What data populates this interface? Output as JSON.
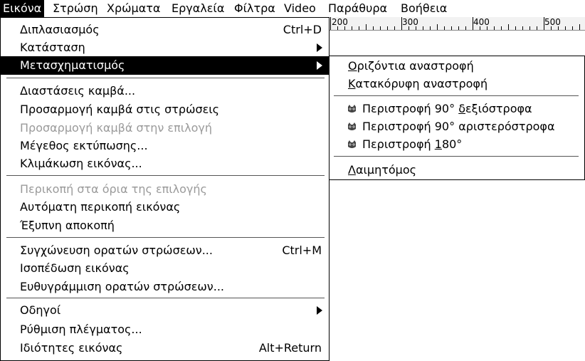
{
  "menubar": {
    "items": [
      "Εικόνα",
      "Στρώση",
      "Χρώματα",
      "Εργαλεία",
      "Φίλτρα",
      "Video",
      "Παράθυρα",
      "Βοήθεια"
    ]
  },
  "ruler": {
    "labels": [
      "200",
      "300",
      "400",
      "500"
    ]
  },
  "image_menu": {
    "duplicate": {
      "label": "Διπλασιασμός",
      "shortcut": "Ctrl+D"
    },
    "mode": {
      "label": "Κατάσταση"
    },
    "transform": {
      "label": "Μετασχηματισμός"
    },
    "canvas_size": {
      "label": "Διαστάσεις καμβά..."
    },
    "fit_canvas_layers": {
      "label": "Προσαρμογή καμβά στις στρώσεις"
    },
    "fit_canvas_selection": {
      "label": "Προσαρμογή καμβά στην επιλογή"
    },
    "print_size": {
      "label": "Μέγεθος εκτύπωσης..."
    },
    "scale_image": {
      "label": "Κλιμάκωση εικόνας..."
    },
    "crop_to_selection": {
      "label": "Περικοπή στα όρια της επιλογής"
    },
    "autocrop": {
      "label": "Αυτόματη περικοπή εικόνας"
    },
    "zealous_crop": {
      "label": "Έξυπνη αποκοπή"
    },
    "merge_visible": {
      "label": "Συγχώνευση ορατών στρώσεων...",
      "shortcut": "Ctrl+M"
    },
    "flatten": {
      "label": "Ισοπέδωση εικόνας"
    },
    "align_visible": {
      "label": "Ευθυγράμμιση ορατών στρώσεων..."
    },
    "guides": {
      "label": "Οδηγοί"
    },
    "configure_grid": {
      "label": "Ρύθμιση πλέγματος..."
    },
    "properties": {
      "label": "Ιδιότητες εικόνας",
      "shortcut": "Alt+Return"
    }
  },
  "transform_submenu": {
    "flip_h": {
      "first": "Ο",
      "rest": "ριζόντια αναστροφή"
    },
    "flip_v": {
      "first": "Κ",
      "rest": "ατακόρυφη αναστροφή"
    },
    "rot_cw": {
      "pre": "Περιστροφή 90° ",
      "u": "δ",
      "post": "εξιόστροφα"
    },
    "rot_ccw": {
      "label": "Περιστροφή 90° αριστερόστροφα"
    },
    "rot_180": {
      "pre": "Περιστροφή ",
      "u": "1",
      "post": "80°"
    },
    "guillotine": {
      "first": "Λ",
      "rest": "αιμητόμος"
    }
  }
}
